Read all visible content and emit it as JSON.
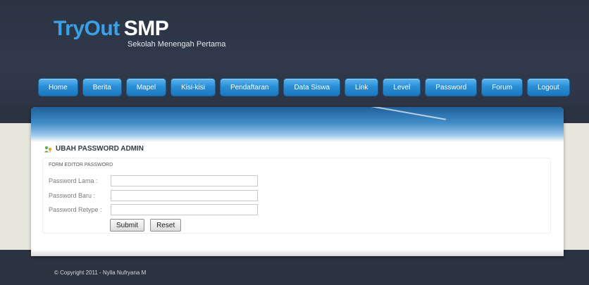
{
  "brand": {
    "name_part1": "TryOut",
    "name_part2": "SMP",
    "tagline": "Sekolah Menengah Pertama"
  },
  "nav": {
    "items": [
      "Home",
      "Berita",
      "Mapel",
      "Kisi-kisi",
      "Pendaftaran",
      "Data Siswa",
      "Link",
      "Level",
      "Password",
      "Forum",
      "Logout"
    ]
  },
  "section": {
    "title": "UBAH PASSWORD ADMIN",
    "icon": "user-key-icon"
  },
  "form": {
    "title": "FORM EDITOR PASSWORD",
    "fields": [
      {
        "label": "Password Lama",
        "separator": ":",
        "value": ""
      },
      {
        "label": "Password Baru",
        "separator": ":",
        "value": ""
      },
      {
        "label": "Password Retype",
        "separator": ":",
        "value": ""
      }
    ],
    "submit_label": "Submit",
    "reset_label": "Reset"
  },
  "footer": {
    "copyright": "© Copyright 2011 - Nylla Nufryana M"
  },
  "colors": {
    "accent": "#3aa0e8",
    "nav_button": "#2a8fd6",
    "background": "#2b3240"
  }
}
